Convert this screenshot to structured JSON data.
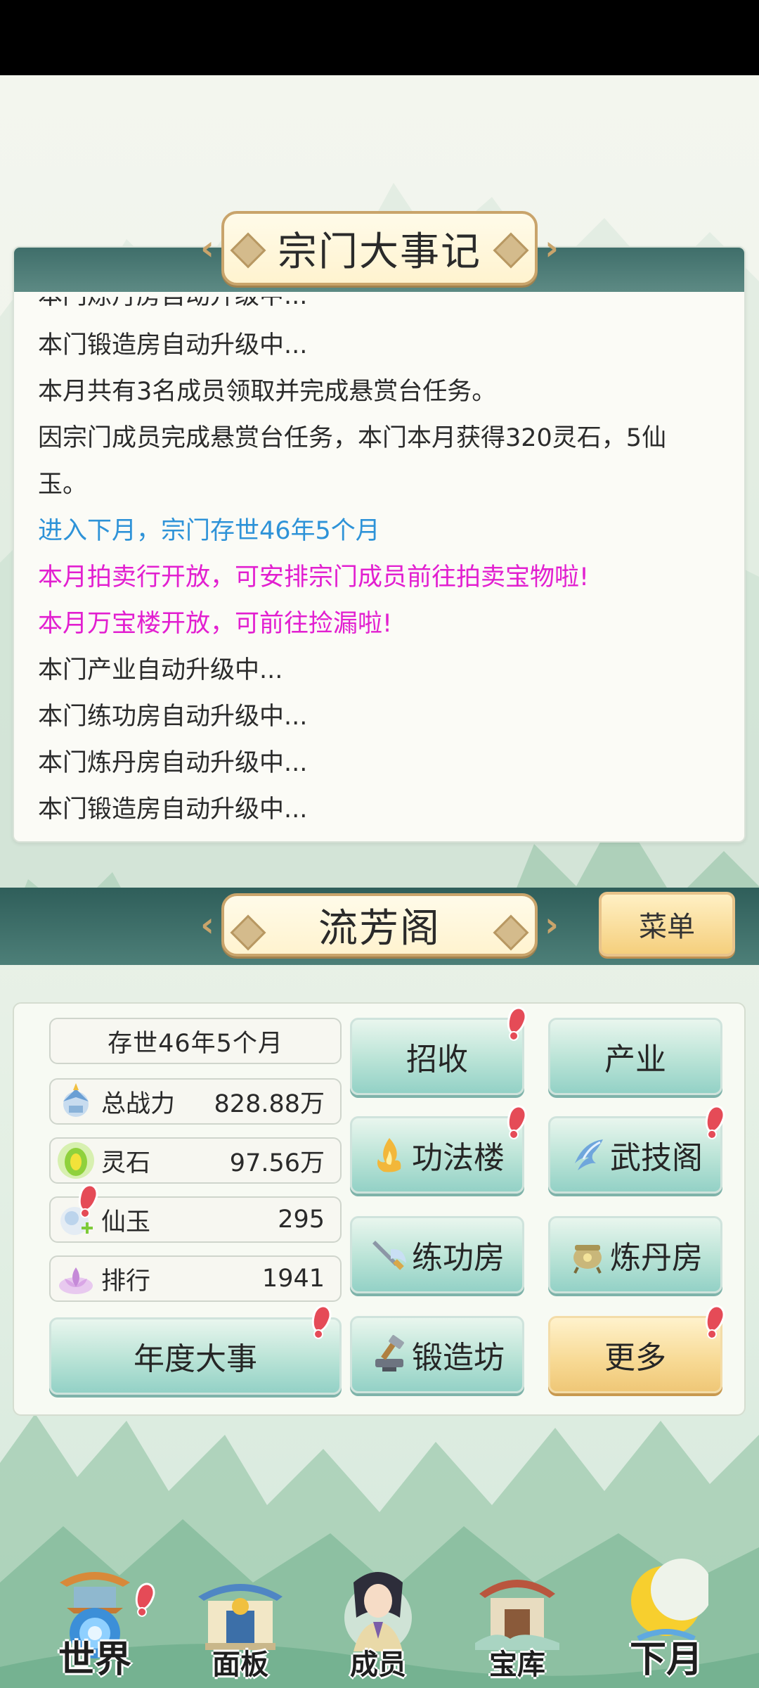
{
  "log_panel": {
    "title": "宗门大事记",
    "cut_line": "本门炼丹房自动升级中...",
    "lines": [
      {
        "text": "本门锻造房自动升级中...",
        "style": "normal"
      },
      {
        "text": "本月共有3名成员领取并完成悬赏台任务。",
        "style": "normal"
      },
      {
        "text": "因宗门成员完成悬赏台任务，本门本月获得320灵石，5仙玉。",
        "style": "normal"
      },
      {
        "text": "进入下月，宗门存世46年5个月",
        "style": "blue"
      },
      {
        "text": "本月拍卖行开放，可安排宗门成员前往拍卖宝物啦!",
        "style": "pink"
      },
      {
        "text": "本月万宝楼开放，可前往捡漏啦!",
        "style": "pink"
      },
      {
        "text": "本门产业自动升级中...",
        "style": "normal"
      },
      {
        "text": "本门练功房自动升级中...",
        "style": "normal"
      },
      {
        "text": "本门炼丹房自动升级中...",
        "style": "normal"
      },
      {
        "text": "本门锻造房自动升级中...",
        "style": "normal"
      }
    ]
  },
  "sect": {
    "name": "流芳阁",
    "menu_label": "菜单",
    "age": "存世46年5个月",
    "stats": {
      "power": {
        "label": "总战力",
        "value": "828.88万",
        "icon": "power-icon"
      },
      "spirit_stone": {
        "label": "灵石",
        "value": "97.56万",
        "icon": "spirit-stone-icon"
      },
      "jade": {
        "label": "仙玉",
        "value": "295",
        "icon": "jade-icon"
      },
      "rank": {
        "label": "排行",
        "value": "1941",
        "icon": "rank-icon"
      }
    },
    "annual_events_label": "年度大事"
  },
  "actions": {
    "recruit": "招收",
    "industry": "产业",
    "skill_tower": "功法楼",
    "martial_pavilion": "武技阁",
    "training_room": "练功房",
    "alchemy_room": "炼丹房",
    "forge": "锻造坊",
    "more": "更多"
  },
  "nav": {
    "world": "世界",
    "panel": "面板",
    "members": "成员",
    "treasury": "宝库",
    "next_month": "下月"
  },
  "colors": {
    "accent_teal": "#3f6e6a",
    "log_blue": "#2e93d8",
    "log_pink": "#e21fd0",
    "alert_red": "#e54b57"
  }
}
